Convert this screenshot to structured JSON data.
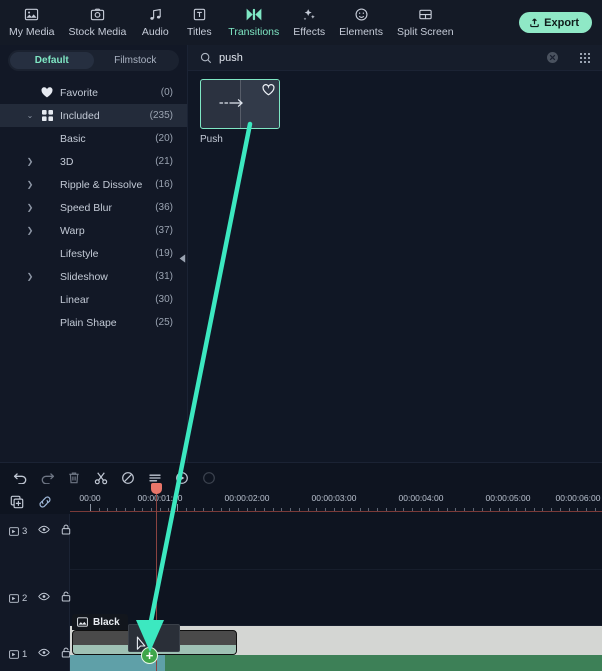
{
  "app": {
    "accent": "#7fe7c4",
    "bg": "#0e1420"
  },
  "topnav": {
    "items": [
      {
        "label": "My Media",
        "icon": "image-icon",
        "active": false
      },
      {
        "label": "Stock Media",
        "icon": "stock-media-icon",
        "active": false
      },
      {
        "label": "Audio",
        "icon": "music-note-icon",
        "active": false
      },
      {
        "label": "Titles",
        "icon": "text-box-icon",
        "active": false
      },
      {
        "label": "Transitions",
        "icon": "transitions-icon",
        "active": true
      },
      {
        "label": "Effects",
        "icon": "sparkles-icon",
        "active": false
      },
      {
        "label": "Elements",
        "icon": "smiley-icon",
        "active": false
      },
      {
        "label": "Split Screen",
        "icon": "split-screen-icon",
        "active": false
      }
    ],
    "export_label": "Export"
  },
  "left_panel": {
    "tabs": [
      {
        "label": "Default",
        "active": true
      },
      {
        "label": "Filmstock",
        "active": false
      }
    ],
    "categories": [
      {
        "label": "Favorite",
        "count": "(0)",
        "icon": "heart-icon",
        "arrow": "none",
        "indent": false,
        "selected": false
      },
      {
        "label": "Included",
        "count": "(235)",
        "icon": "grid-icon",
        "arrow": "down",
        "indent": false,
        "selected": true
      },
      {
        "label": "Basic",
        "count": "(20)",
        "icon": "none",
        "arrow": "none",
        "indent": true,
        "selected": false
      },
      {
        "label": "3D",
        "count": "(21)",
        "icon": "none",
        "arrow": "right",
        "indent": true,
        "selected": false
      },
      {
        "label": "Ripple & Dissolve",
        "count": "(16)",
        "icon": "none",
        "arrow": "right",
        "indent": true,
        "selected": false
      },
      {
        "label": "Speed Blur",
        "count": "(36)",
        "icon": "none",
        "arrow": "right",
        "indent": true,
        "selected": false
      },
      {
        "label": "Warp",
        "count": "(37)",
        "icon": "none",
        "arrow": "right",
        "indent": true,
        "selected": false
      },
      {
        "label": "Lifestyle",
        "count": "(19)",
        "icon": "none",
        "arrow": "none",
        "indent": true,
        "selected": false
      },
      {
        "label": "Slideshow",
        "count": "(31)",
        "icon": "none",
        "arrow": "right",
        "indent": true,
        "selected": false
      },
      {
        "label": "Linear",
        "count": "(30)",
        "icon": "none",
        "arrow": "none",
        "indent": true,
        "selected": false
      },
      {
        "label": "Plain Shape",
        "count": "(25)",
        "icon": "none",
        "arrow": "none",
        "indent": true,
        "selected": false
      }
    ]
  },
  "search": {
    "value": "push",
    "placeholder": "Search"
  },
  "results": [
    {
      "label": "Push",
      "selected": true,
      "favorited": false
    }
  ],
  "timeline": {
    "toolbar": [
      {
        "name": "undo-button",
        "icon": "undo-icon"
      },
      {
        "name": "redo-button",
        "icon": "redo-icon"
      },
      {
        "name": "delete-button",
        "icon": "trash-icon"
      },
      {
        "name": "split-button",
        "icon": "scissors-icon"
      },
      {
        "name": "crop-button",
        "icon": "crop-icon"
      },
      {
        "name": "adjust-button",
        "icon": "sliders-icon"
      },
      {
        "name": "speed-button",
        "icon": "speed-icon"
      },
      {
        "name": "more-button",
        "icon": "more-icon"
      }
    ],
    "ruler_labels": [
      "00:00",
      "00:00:01:00",
      "00:00:02:00",
      "00:00:03:00",
      "00:00:04:00",
      "00:00:05:00",
      "00:00:06:00"
    ],
    "playhead_time": "00:00:01:00",
    "tracks": [
      {
        "number": "3",
        "visible": true,
        "locked": true
      },
      {
        "number": "2",
        "visible": true,
        "locked": false
      },
      {
        "number": "1",
        "visible": true,
        "locked": false
      }
    ],
    "clips": [
      {
        "name": "Black",
        "track": "1",
        "icon": "image-icon"
      }
    ],
    "drop_indicator": "add-plus-badge"
  }
}
